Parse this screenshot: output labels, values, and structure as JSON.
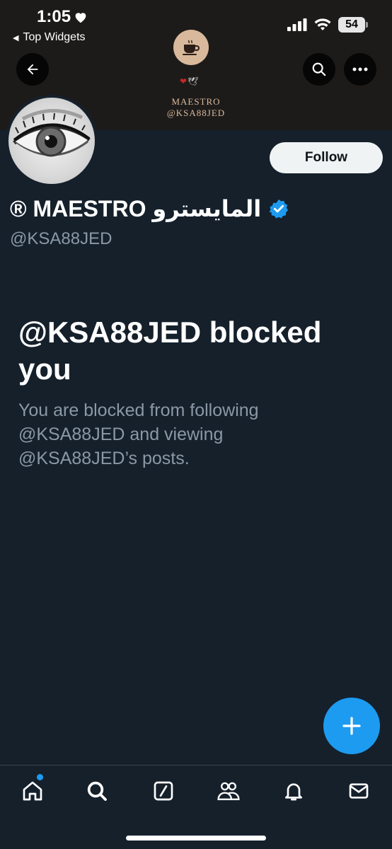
{
  "status_bar": {
    "time": "1:05",
    "back_app": "Top Widgets",
    "battery": "54"
  },
  "header": {
    "back_icon": "arrow-left-icon",
    "search_icon": "search-icon",
    "more_icon": "more-horizontal-icon",
    "brand_line1": "MAESTRO",
    "brand_line2": "@KSA88JED"
  },
  "profile": {
    "display_name": "® MAESTRO المايسترو",
    "handle": "@KSA88JED",
    "follow_label": "Follow",
    "verified_color": "#1d9bf0"
  },
  "blocked": {
    "title": "@KSA88JED blocked you",
    "description": "You are blocked from following @KSA88JED and viewing @KSA88JED’s posts."
  },
  "colors": {
    "background": "#15202b",
    "accent": "#1d9bf0",
    "muted_text": "#8b98a5"
  },
  "tab_bar": {
    "items": [
      "home-icon",
      "search-icon",
      "grok-icon",
      "communities-icon",
      "notifications-icon",
      "messages-icon"
    ]
  }
}
